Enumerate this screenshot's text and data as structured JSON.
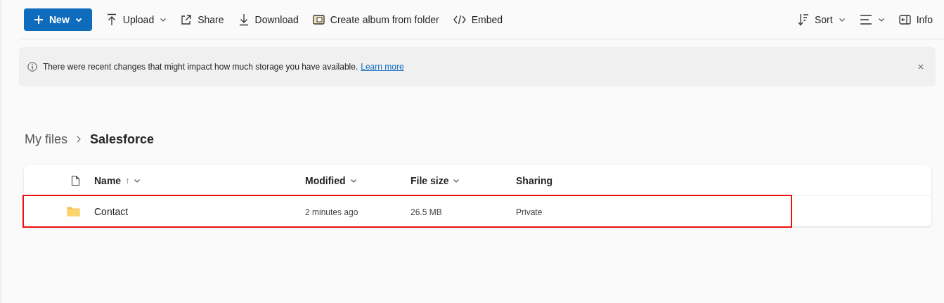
{
  "toolbar": {
    "new_button": "New",
    "actions": [
      {
        "kind": "upload",
        "label": "Upload",
        "dropdown": true
      },
      {
        "kind": "share",
        "label": "Share",
        "dropdown": false
      },
      {
        "kind": "download",
        "label": "Download",
        "dropdown": false
      },
      {
        "kind": "album",
        "label": "Create album from folder",
        "dropdown": false
      },
      {
        "kind": "embed",
        "label": "Embed",
        "dropdown": false
      }
    ],
    "right_actions": [
      {
        "kind": "sort",
        "label": "Sort",
        "dropdown": true
      },
      {
        "kind": "view",
        "dropdown": true
      },
      {
        "kind": "info",
        "label": "Info",
        "dropdown": false
      }
    ]
  },
  "banner": {
    "message": "There were recent changes that might impact how much storage you have available.",
    "link": "Learn more"
  },
  "breadcrumb": [
    "My files",
    "Salesforce"
  ],
  "table": {
    "columns": [
      {
        "label": "Name",
        "sort_arrow": "↑"
      },
      {
        "label": "Modified"
      },
      {
        "label": "File size"
      },
      {
        "label": "Sharing"
      }
    ],
    "rows": [
      {
        "kind": "folder",
        "name": "Contact",
        "modified": "2 minutes ago",
        "size": "26.5 MB",
        "sharing": "Private",
        "highlighted": true
      }
    ]
  }
}
